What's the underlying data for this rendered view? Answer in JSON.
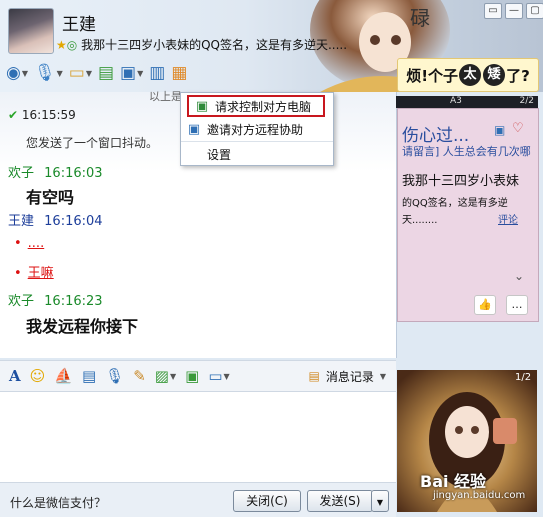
{
  "window": {
    "user_name": "王建",
    "signature": "我那十三四岁小表妹的QQ签名，这是有多逆天.....",
    "controls": [
      "▭",
      "—",
      "▢",
      "✕"
    ]
  },
  "toolbar": {
    "items": [
      {
        "icon": "video-icon"
      },
      {
        "icon": "microphone-icon"
      },
      {
        "icon": "file-transfer-icon"
      },
      {
        "icon": "sms-icon"
      },
      {
        "icon": "remote-desktop-icon"
      },
      {
        "icon": "share-screen-icon"
      },
      {
        "icon": "apps-icon"
      }
    ]
  },
  "banner": {
    "part1": "烦!个子",
    "dot1": "太",
    "dot2": "矮",
    "part2": "了?"
  },
  "remote_menu": {
    "items": [
      {
        "label": "请求控制对方电脑",
        "highlighted": true
      },
      {
        "label": "邀请对方远程协助"
      },
      {
        "label": "设置"
      }
    ]
  },
  "chat": {
    "partial_text": "以上是",
    "messages": [
      {
        "time": "16:15:59",
        "system": "您发送了一个窗口抖动。"
      },
      {
        "sender": "欢子",
        "time": "16:16:03",
        "text": "有空吗"
      },
      {
        "sender": "王建",
        "time": "16:16:04",
        "lines": [
          "....",
          "王嘛"
        ]
      },
      {
        "sender": "欢子",
        "time": "16:16:23",
        "text": "我发远程你接下"
      }
    ]
  },
  "side_top": {
    "pager": "2/2",
    "label": "A3",
    "title": "伤心过...",
    "subtitle": "请留言] 人生总会有几次哪",
    "body": "我那十三四岁小表妹",
    "body2": "的QQ签名，这是有多逆天........",
    "comment": "评论"
  },
  "format_bar": {
    "history_label": "消息记录"
  },
  "footer": {
    "wechat_pay": "什么是微信支付？",
    "close_label": "关闭(C)",
    "send_label": "发送(S)"
  },
  "side_bottom": {
    "pager": "1/2",
    "watermark": "Bai 经验",
    "watermark_sub": "jingyan.baidu.com"
  }
}
